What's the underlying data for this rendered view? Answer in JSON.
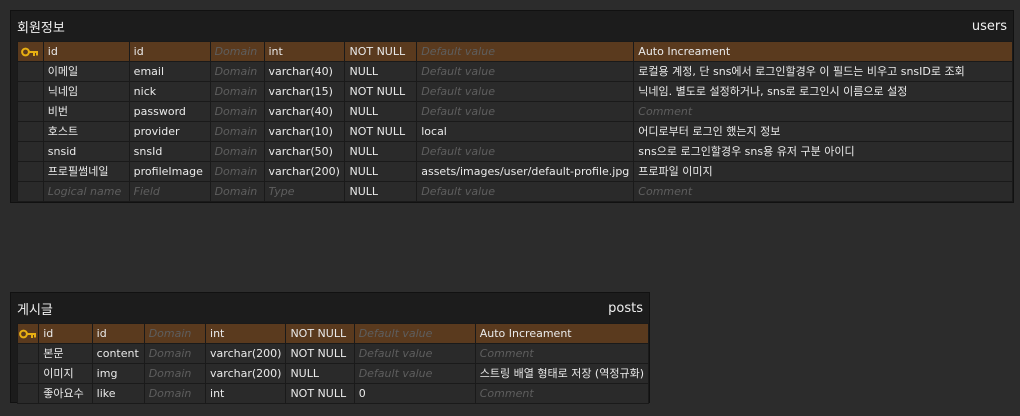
{
  "tables": [
    {
      "logical_name": "회원정보",
      "physical_name": "users",
      "columns": [
        {
          "key": true,
          "logical": "id",
          "physical": "id",
          "domain": "Domain",
          "type": "int",
          "nullable": "NOT NULL",
          "default": "Default value",
          "comment": "Auto Increament"
        },
        {
          "key": false,
          "logical": "이메일",
          "physical": "email",
          "domain": "Domain",
          "type": "varchar(40)",
          "nullable": "NULL",
          "default": "Default value",
          "comment": "로컬용 계정, 단 sns에서 로그인할경우 이 필드는 비우고 snsID로 조회"
        },
        {
          "key": false,
          "logical": "닉네임",
          "physical": "nick",
          "domain": "Domain",
          "type": "varchar(15)",
          "nullable": "NOT NULL",
          "default": "Default value",
          "comment": "닉네임. 별도로 설정하거나, sns로 로그인시 이름으로 설정"
        },
        {
          "key": false,
          "logical": "비번",
          "physical": "password",
          "domain": "Domain",
          "type": "varchar(40)",
          "nullable": "NULL",
          "default": "Default value",
          "comment": "Comment"
        },
        {
          "key": false,
          "logical": "호스트",
          "physical": "provider",
          "domain": "Domain",
          "type": "varchar(10)",
          "nullable": "NOT NULL",
          "default": "local",
          "comment": "어디로부터 로그인 했는지 정보"
        },
        {
          "key": false,
          "logical": "snsid",
          "physical": "snsId",
          "domain": "Domain",
          "type": "varchar(50)",
          "nullable": "NULL",
          "default": "Default value",
          "comment": "sns으로 로그인할경우 sns용 유저 구분 아이디"
        },
        {
          "key": false,
          "logical": "프로필썸네일",
          "physical": "profileImage",
          "domain": "Domain",
          "type": "varchar(200)",
          "nullable": "NULL",
          "default": "assets/images/user/default-profile.jpg",
          "comment": "프로파일 이미지"
        },
        {
          "key": false,
          "logical": "Logical name",
          "physical": "Field",
          "domain": "Domain",
          "type": "Type",
          "nullable": "NULL",
          "default": "Default value",
          "comment": "Comment"
        }
      ]
    },
    {
      "logical_name": "게시글",
      "physical_name": "posts",
      "columns": [
        {
          "key": true,
          "logical": "id",
          "physical": "id",
          "domain": "Domain",
          "type": "int",
          "nullable": "NOT NULL",
          "default": "Default value",
          "comment": "Auto Increament"
        },
        {
          "key": false,
          "logical": "본문",
          "physical": "content",
          "domain": "Domain",
          "type": "varchar(200)",
          "nullable": "NOT NULL",
          "default": "Default value",
          "comment": "Comment"
        },
        {
          "key": false,
          "logical": "이미지",
          "physical": "img",
          "domain": "Domain",
          "type": "varchar(200)",
          "nullable": "NULL",
          "default": "Default value",
          "comment": "스트링 배열 형태로 저장 (역정규화)"
        },
        {
          "key": false,
          "logical": "좋아요수",
          "physical": "like",
          "domain": "Domain",
          "type": "int",
          "nullable": "NOT NULL",
          "default": "0",
          "comment": "Comment"
        }
      ]
    }
  ],
  "placeholders": {
    "logical": "Logical name",
    "physical": "Field",
    "domain": "Domain",
    "type": "Type",
    "default": "Default value",
    "comment": "Comment"
  },
  "colors": {
    "background": "#2c2c2c",
    "card": "#1c1c1c",
    "cell": "#2a2a2a",
    "pk_row": "#5a3a1e",
    "placeholder_text": "#5e5e5e",
    "key_icon": "#e8b012"
  },
  "icons": {
    "primary_key": "key-icon"
  }
}
